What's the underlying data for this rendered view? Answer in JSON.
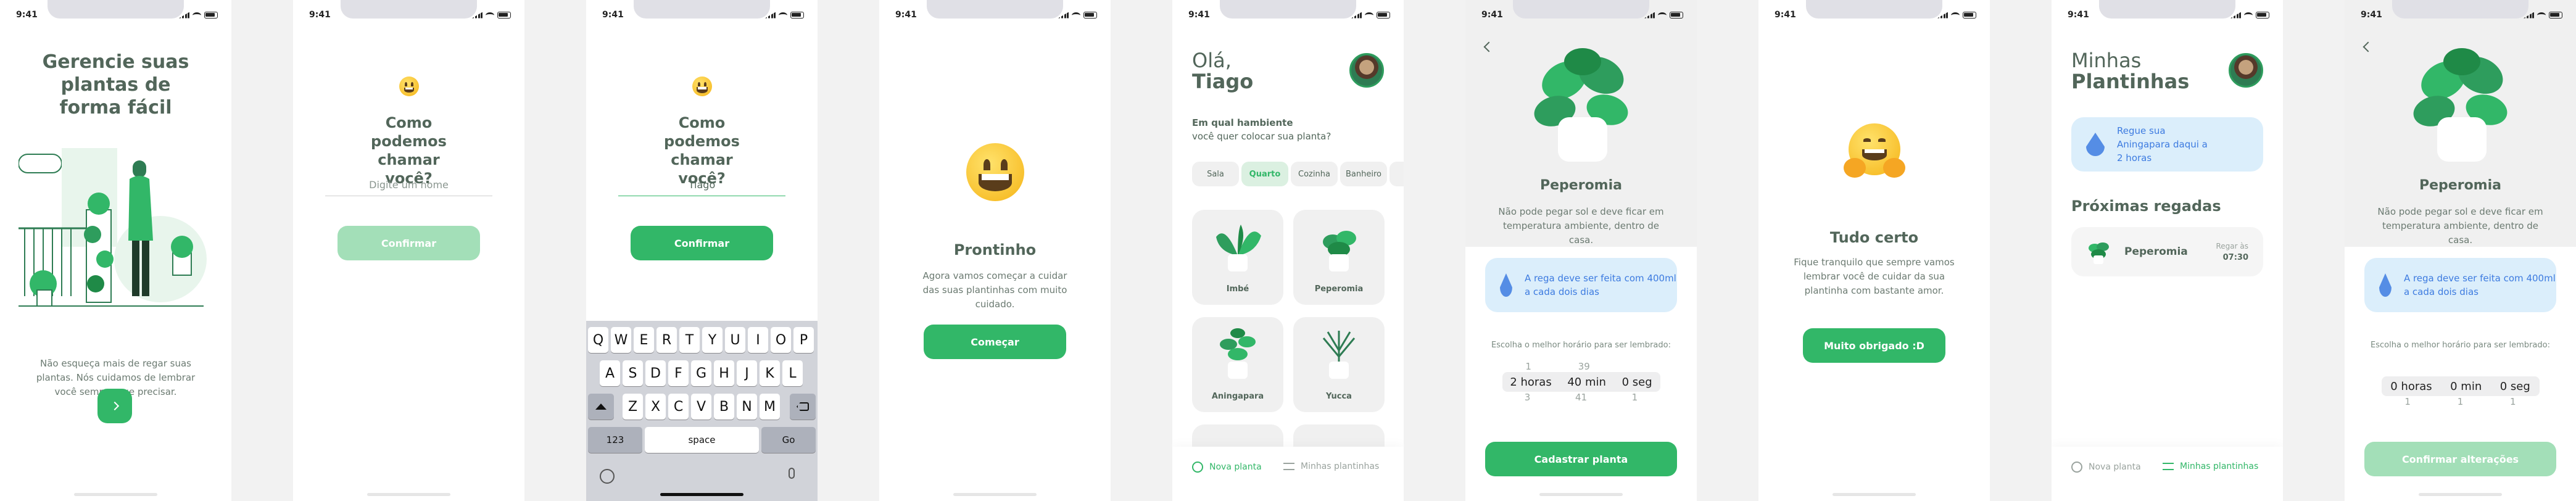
{
  "status": {
    "time": "9:41"
  },
  "s1": {
    "title": "Gerencie suas plantas de forma fácil",
    "description": "Não esqueça mais de regar suas plantas. Nós cuidamos de lembrar você sempre que precisar.",
    "next_icon": "chevron-right-icon"
  },
  "s2": {
    "title": "Como podemos chamar você?",
    "placeholder": "Digite um nome",
    "button": "Confirmar"
  },
  "s3": {
    "title": "Como podemos chamar você?",
    "value": "Tiago",
    "button": "Confirmar",
    "keyboard": {
      "row1": [
        "Q",
        "W",
        "E",
        "R",
        "T",
        "Y",
        "U",
        "I",
        "O",
        "P"
      ],
      "row2": [
        "A",
        "S",
        "D",
        "F",
        "G",
        "H",
        "J",
        "K",
        "L"
      ],
      "row3": [
        "Z",
        "X",
        "C",
        "V",
        "B",
        "N",
        "M"
      ],
      "num": "123",
      "space": "space",
      "go": "Go"
    }
  },
  "s4": {
    "title": "Prontinho",
    "description": "Agora vamos começar a cuidar das suas plantinhas com muito cuidado.",
    "button": "Começar"
  },
  "s5": {
    "greeting": "Olá,",
    "name": "Tiago",
    "question_bold": "Em qual hambiente",
    "question": "você quer colocar sua planta?",
    "rooms": [
      "Sala",
      "Quarto",
      "Cozinha",
      "Banheiro"
    ],
    "active_room": "Quarto",
    "plants": [
      "Imbé",
      "Peperomia",
      "Aningapara",
      "Yucca"
    ],
    "tab_new": "Nova planta",
    "tab_mine": "Minhas plantinhas"
  },
  "s6": {
    "name": "Peperomia",
    "about": "Não pode pegar sol e deve ficar em temperatura ambiente, dentro de casa.",
    "water_tip": "A rega deve ser feita com 400ml a cada dois dias",
    "picker_hint": "Escolha o melhor horário para ser lembrado:",
    "picker_above": [
      "1",
      "39",
      ""
    ],
    "picker_selected": [
      "2 horas",
      "40 min",
      "0 seg"
    ],
    "picker_below": [
      "3",
      "41",
      "1"
    ],
    "button": "Cadastrar planta"
  },
  "s7": {
    "title": "Tudo certo",
    "description": "Fique tranquilo que sempre vamos lembrar você de cuidar da sua plantinha com bastante amor.",
    "button": "Muito obrigado :D"
  },
  "s8": {
    "title_light": "Minhas",
    "title_bold": "Plantinhas",
    "reminder": "Regue sua Aningapara daqui a 2 horas",
    "section": "Próximas regadas",
    "item_name": "Peperomia",
    "item_label": "Regar às",
    "item_time": "07:30",
    "tab_new": "Nova planta",
    "tab_mine": "Minhas plantinhas"
  },
  "s9": {
    "name": "Peperomia",
    "about": "Não pode pegar sol e deve ficar em temperatura ambiente, dentro de casa.",
    "water_tip": "A rega deve ser feita com 400ml a cada dois dias",
    "picker_hint": "Escolha o melhor horário para ser lembrado:",
    "picker_selected": [
      "0 horas",
      "0 min",
      "0 seg"
    ],
    "picker_below": [
      "1",
      "1",
      "1"
    ],
    "button": "Confirmar alterações"
  },
  "colors": {
    "green": "#32b768",
    "green_light": "#dbf0e1",
    "blue_box": "#dbeefb",
    "blue": "#3d7be0",
    "heading": "#52665a"
  }
}
